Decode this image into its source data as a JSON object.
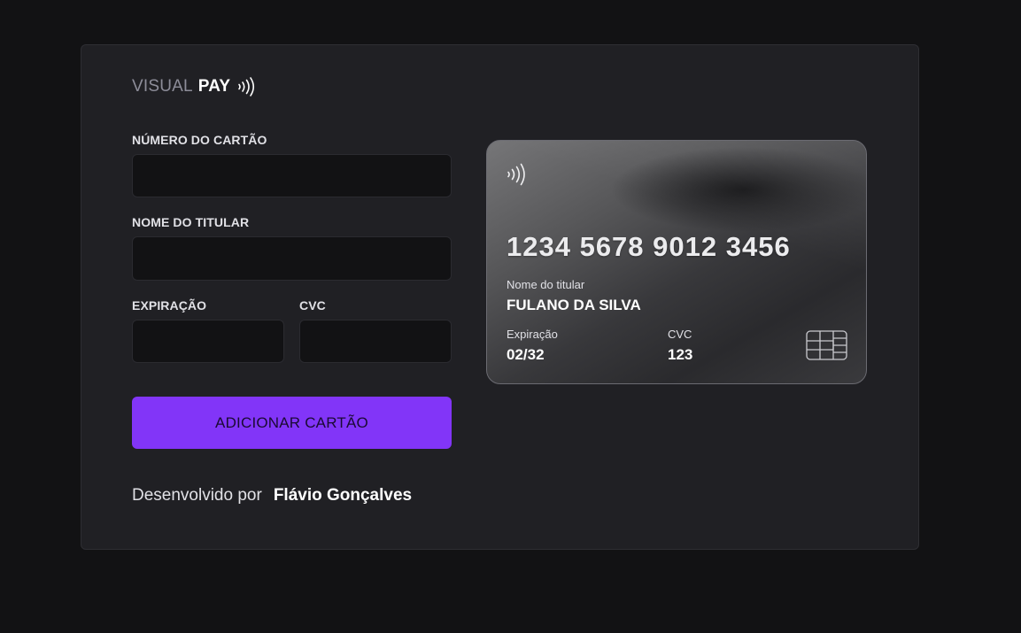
{
  "brand": {
    "light": "VISUAL",
    "bold": "PAY",
    "icon": "contactless-icon"
  },
  "form": {
    "card_number_label": "NÚMERO DO CARTÃO",
    "card_number_value": "",
    "holder_label": "NOME DO TITULAR",
    "holder_value": "",
    "expiry_label": "EXPIRAÇÃO",
    "expiry_value": "",
    "cvc_label": "CVC",
    "cvc_value": "",
    "submit_label": "ADICIONAR CARTÃO"
  },
  "footer": {
    "prefix": "Desenvolvido por",
    "author": "Flávio Gonçalves"
  },
  "card": {
    "contactless_icon": "contactless-icon",
    "number": "1234 5678 9012 3456",
    "holder_caption": "Nome do titular",
    "holder_name": "FULANO DA SILVA",
    "expiry_caption": "Expiração",
    "expiry_value": "02/32",
    "cvc_caption": "CVC",
    "cvc_value": "123",
    "chip_icon": "chip-icon"
  },
  "colors": {
    "background": "#121214",
    "panel": "#202024",
    "input": "#121214",
    "accent": "#8235f8"
  }
}
